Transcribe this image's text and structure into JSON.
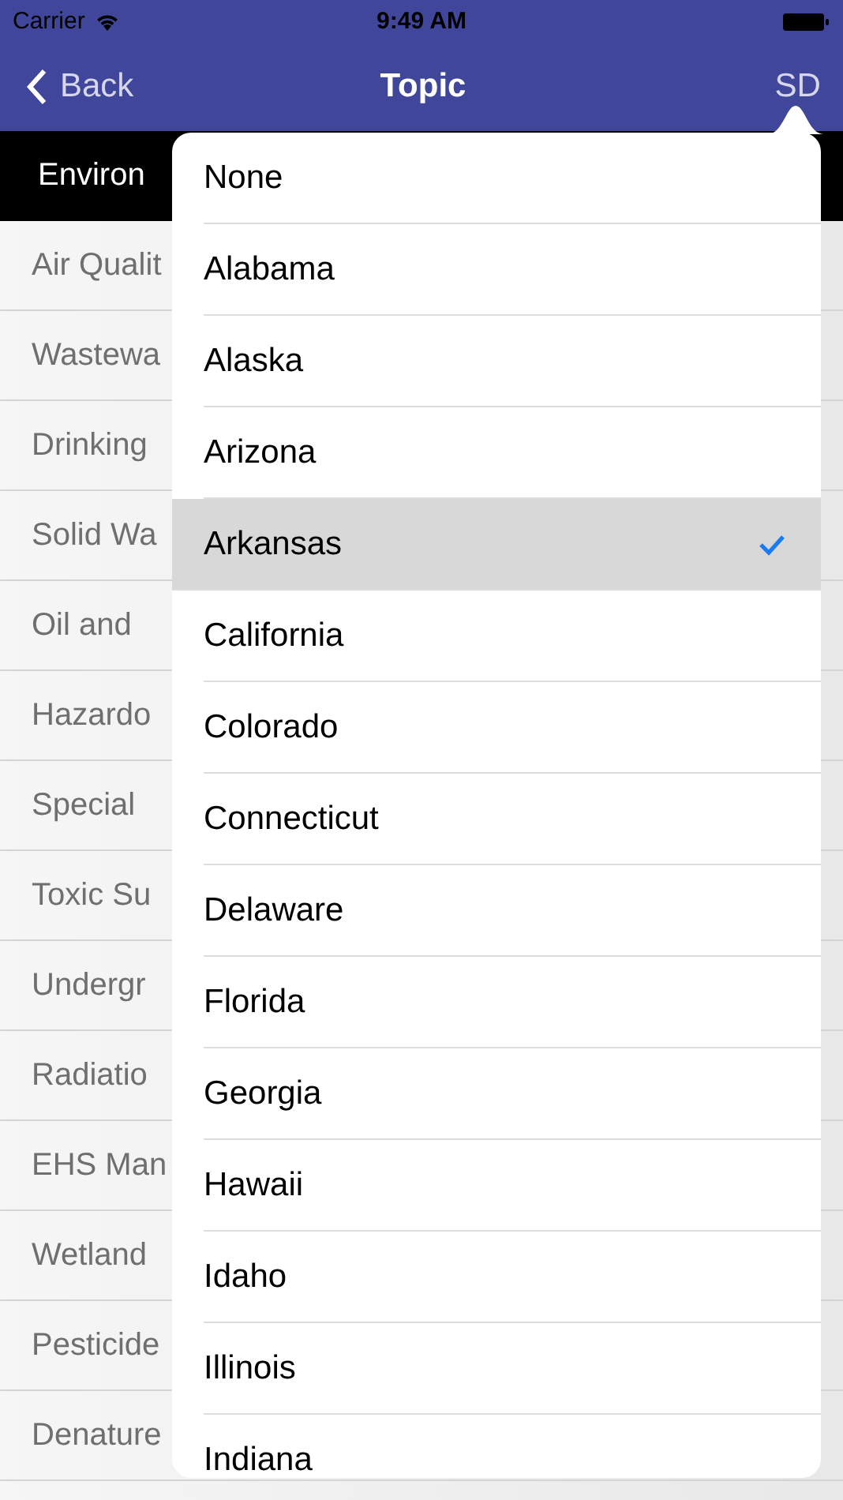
{
  "status_bar": {
    "carrier": "Carrier",
    "time": "9:49 AM"
  },
  "nav_bar": {
    "back": "Back",
    "title": "Topic",
    "right_button": "SD"
  },
  "section_header": "Environ",
  "topics": [
    "Air Qualit",
    "Wastewa",
    "Drinking",
    "Solid Wa",
    "Oil and",
    "Hazardo",
    "Special",
    "Toxic Su",
    "Undergr",
    "Radiatio",
    "EHS Man",
    "Wetland",
    "Pesticide",
    "Denature"
  ],
  "popover": {
    "items": [
      {
        "label": "None",
        "selected": false
      },
      {
        "label": "Alabama",
        "selected": false
      },
      {
        "label": "Alaska",
        "selected": false
      },
      {
        "label": "Arizona",
        "selected": false
      },
      {
        "label": "Arkansas",
        "selected": true
      },
      {
        "label": "California",
        "selected": false
      },
      {
        "label": "Colorado",
        "selected": false
      },
      {
        "label": "Connecticut",
        "selected": false
      },
      {
        "label": "Delaware",
        "selected": false
      },
      {
        "label": "Florida",
        "selected": false
      },
      {
        "label": "Georgia",
        "selected": false
      },
      {
        "label": "Hawaii",
        "selected": false
      },
      {
        "label": "Idaho",
        "selected": false
      },
      {
        "label": "Illinois",
        "selected": false
      },
      {
        "label": "Indiana",
        "selected": false
      }
    ]
  }
}
